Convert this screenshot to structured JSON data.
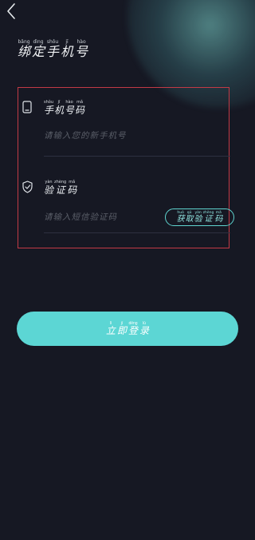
{
  "colors": {
    "background": "#161823",
    "accent": "#5cd6d4",
    "highlight_border": "#c23a46"
  },
  "header": {
    "back_icon": "chevron-left-icon",
    "title_chars": [
      {
        "py": "bǎng",
        "hz": "绑"
      },
      {
        "py": "dìng",
        "hz": "定"
      },
      {
        "py": "shǒu",
        "hz": "手"
      },
      {
        "py": "jī",
        "hz": "机"
      },
      {
        "py": "hào",
        "hz": "号"
      }
    ]
  },
  "phone_field": {
    "icon": "phone-icon",
    "label_chars": [
      {
        "py": "shǒu",
        "hz": "手"
      },
      {
        "py": "jī",
        "hz": "机"
      },
      {
        "py": "hào",
        "hz": "号"
      },
      {
        "py": "mǎ",
        "hz": "码"
      }
    ],
    "value": "",
    "placeholder": "请输入您的新手机号"
  },
  "code_field": {
    "icon": "shield-check-icon",
    "label_chars": [
      {
        "py": "yàn",
        "hz": "验"
      },
      {
        "py": "zhèng",
        "hz": "证"
      },
      {
        "py": "mǎ",
        "hz": "码"
      }
    ],
    "value": "",
    "placeholder": "请输入短信验证码",
    "get_code_chars": [
      {
        "py": "huò",
        "hz": "获"
      },
      {
        "py": "qǔ",
        "hz": "取"
      },
      {
        "py": "yàn",
        "hz": "验"
      },
      {
        "py": "zhèng",
        "hz": "证"
      },
      {
        "py": "mǎ",
        "hz": "码"
      }
    ]
  },
  "login_button": {
    "chars": [
      {
        "py": "lì",
        "hz": "立"
      },
      {
        "py": "jí",
        "hz": "即"
      },
      {
        "py": "dēng",
        "hz": "登"
      },
      {
        "py": "lù",
        "hz": "录"
      }
    ]
  }
}
